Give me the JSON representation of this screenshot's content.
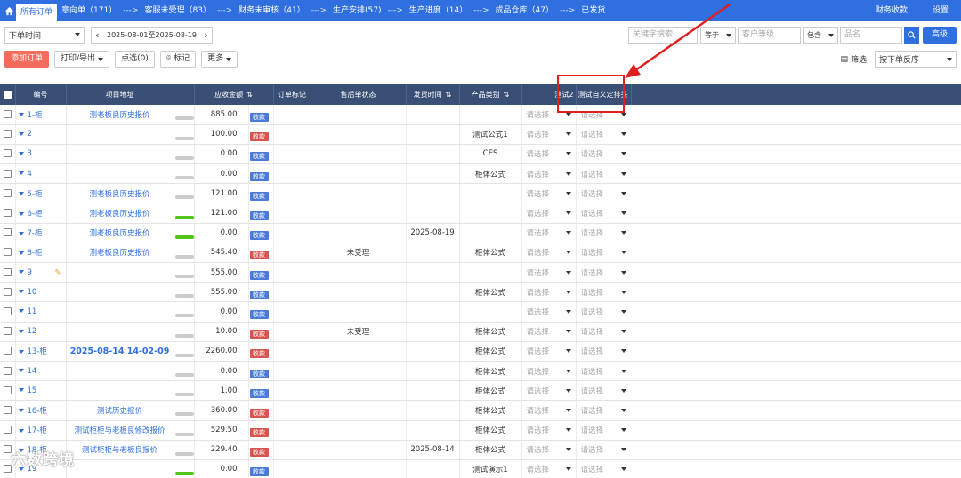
{
  "topnav": {
    "tabs": [
      {
        "label": "所有订单",
        "active": true
      },
      {
        "label": "意向单（171）"
      },
      {
        "label": "客服未受理（83）"
      },
      {
        "label": "财务未审核（41）"
      },
      {
        "label": "生产安排(57)"
      },
      {
        "label": "生产进度（14）"
      },
      {
        "label": "成品仓库（47）"
      },
      {
        "label": "已发货"
      }
    ],
    "arrow": "--->",
    "right": [
      "财务收款",
      "设置"
    ]
  },
  "filters": {
    "time_type": "下单时间",
    "date_range": "2025-08-01至2025-08-19",
    "keyword_placeholder": "关键字搜索",
    "op1": "等于",
    "field1_placeholder": "客户等级",
    "op2": "包含",
    "field2_placeholder": "品名",
    "advanced": "高级"
  },
  "toolbar": {
    "add_order": "添加订单",
    "print_export": "打印/导出",
    "pick": "点选(0)",
    "mark": "标记",
    "more": "更多",
    "filter": "筛选",
    "sort": "按下单反序"
  },
  "table": {
    "headers": {
      "no": "编号",
      "addr": "项目地址",
      "amount": "应收金额",
      "mark": "订单标记",
      "after_sale": "售后单状态",
      "ship_time": "发货时间",
      "category": "产品类别",
      "test2": "测试2",
      "custom": "测试自义定排头"
    },
    "placeholder": "请选择",
    "rows": [
      {
        "no": "1-柜",
        "addr": "测老板良历史报价",
        "amount": "885.00",
        "badge": "收款",
        "paid": false,
        "progress": 0,
        "after_sale": "",
        "ship": "",
        "cat": ""
      },
      {
        "no": "2",
        "addr": "",
        "amount": "100.00",
        "badge": "收款",
        "paid": true,
        "progress": 0,
        "after_sale": "",
        "ship": "",
        "cat": "测试公式1"
      },
      {
        "no": "3",
        "addr": "",
        "amount": "0.00",
        "badge": "收款",
        "paid": false,
        "progress": 0,
        "after_sale": "",
        "ship": "",
        "cat": "CES"
      },
      {
        "no": "4",
        "addr": "",
        "amount": "0.00",
        "badge": "收款",
        "paid": false,
        "progress": 0,
        "after_sale": "",
        "ship": "",
        "cat": "柜体公式"
      },
      {
        "no": "5-柜",
        "addr": "测老板良历史报价",
        "amount": "121.00",
        "badge": "收款",
        "paid": false,
        "progress": 0,
        "after_sale": "",
        "ship": "",
        "cat": ""
      },
      {
        "no": "6-柜",
        "addr": "测老板良历史报价",
        "amount": "121.00",
        "badge": "收款",
        "paid": false,
        "progress": 1,
        "after_sale": "",
        "ship": "",
        "cat": ""
      },
      {
        "no": "7-柜",
        "addr": "测老板良历史报价",
        "amount": "0.00",
        "badge": "收款",
        "paid": false,
        "progress": 1,
        "after_sale": "",
        "ship": "2025-08-19",
        "cat": ""
      },
      {
        "no": "8-柜",
        "addr": "测老板良历史报价",
        "amount": "545.40",
        "badge": "收款",
        "paid": true,
        "progress": 0,
        "after_sale": "未受理",
        "ship": "",
        "cat": "柜体公式"
      },
      {
        "no": "9",
        "addr": "",
        "amount": "555.00",
        "badge": "收款",
        "paid": false,
        "progress": 0,
        "after_sale": "",
        "ship": "",
        "cat": "",
        "pen": true
      },
      {
        "no": "10",
        "addr": "",
        "amount": "555.00",
        "badge": "收款",
        "paid": false,
        "progress": 0,
        "after_sale": "",
        "ship": "",
        "cat": "柜体公式"
      },
      {
        "no": "11",
        "addr": "",
        "amount": "0.00",
        "badge": "收款",
        "paid": false,
        "progress": 0,
        "after_sale": "",
        "ship": "",
        "cat": ""
      },
      {
        "no": "12",
        "addr": "",
        "amount": "10.00",
        "badge": "收款",
        "paid": true,
        "progress": 0,
        "after_sale": "未受理",
        "ship": "",
        "cat": "柜体公式"
      },
      {
        "no": "13-柜",
        "addr": "2025-08-14 14-02-09",
        "addr_big": true,
        "amount": "2260.00",
        "badge": "收款",
        "paid": true,
        "progress": 0,
        "after_sale": "",
        "ship": "",
        "cat": "柜体公式"
      },
      {
        "no": "14",
        "addr": "",
        "amount": "0.00",
        "badge": "收款",
        "paid": false,
        "progress": 0,
        "after_sale": "",
        "ship": "",
        "cat": "柜体公式"
      },
      {
        "no": "15",
        "addr": "",
        "amount": "1.00",
        "badge": "收款",
        "paid": false,
        "progress": 0,
        "after_sale": "",
        "ship": "",
        "cat": "柜体公式"
      },
      {
        "no": "16-柜",
        "addr": "测试历史报价",
        "amount": "360.00",
        "badge": "收款",
        "paid": true,
        "progress": 0,
        "after_sale": "",
        "ship": "",
        "cat": "柜体公式"
      },
      {
        "no": "17-柜",
        "addr": "测试柜柜与老板良修改报价",
        "amount": "529.50",
        "badge": "收款",
        "paid": true,
        "progress": 0,
        "after_sale": "",
        "ship": "",
        "cat": "柜体公式"
      },
      {
        "no": "18-柜",
        "addr": "测试柜柜与老板良报价",
        "amount": "229.40",
        "badge": "收款",
        "paid": true,
        "progress": 0,
        "after_sale": "",
        "ship": "2025-08-14",
        "cat": "柜体公式"
      },
      {
        "no": "19",
        "addr": "",
        "amount": "0.00",
        "badge": "收款",
        "paid": false,
        "progress": 1,
        "after_sale": "",
        "ship": "",
        "cat": "测试演示1"
      }
    ]
  },
  "watermark": "六数跨境",
  "colors": {
    "brand": "#2f6fe0",
    "header": "#394f75",
    "paid": "#d9534f",
    "unpaid": "#4a7bd8",
    "progress": "#52c41a",
    "add": "#f56b5c",
    "highlight": "#e02020"
  }
}
